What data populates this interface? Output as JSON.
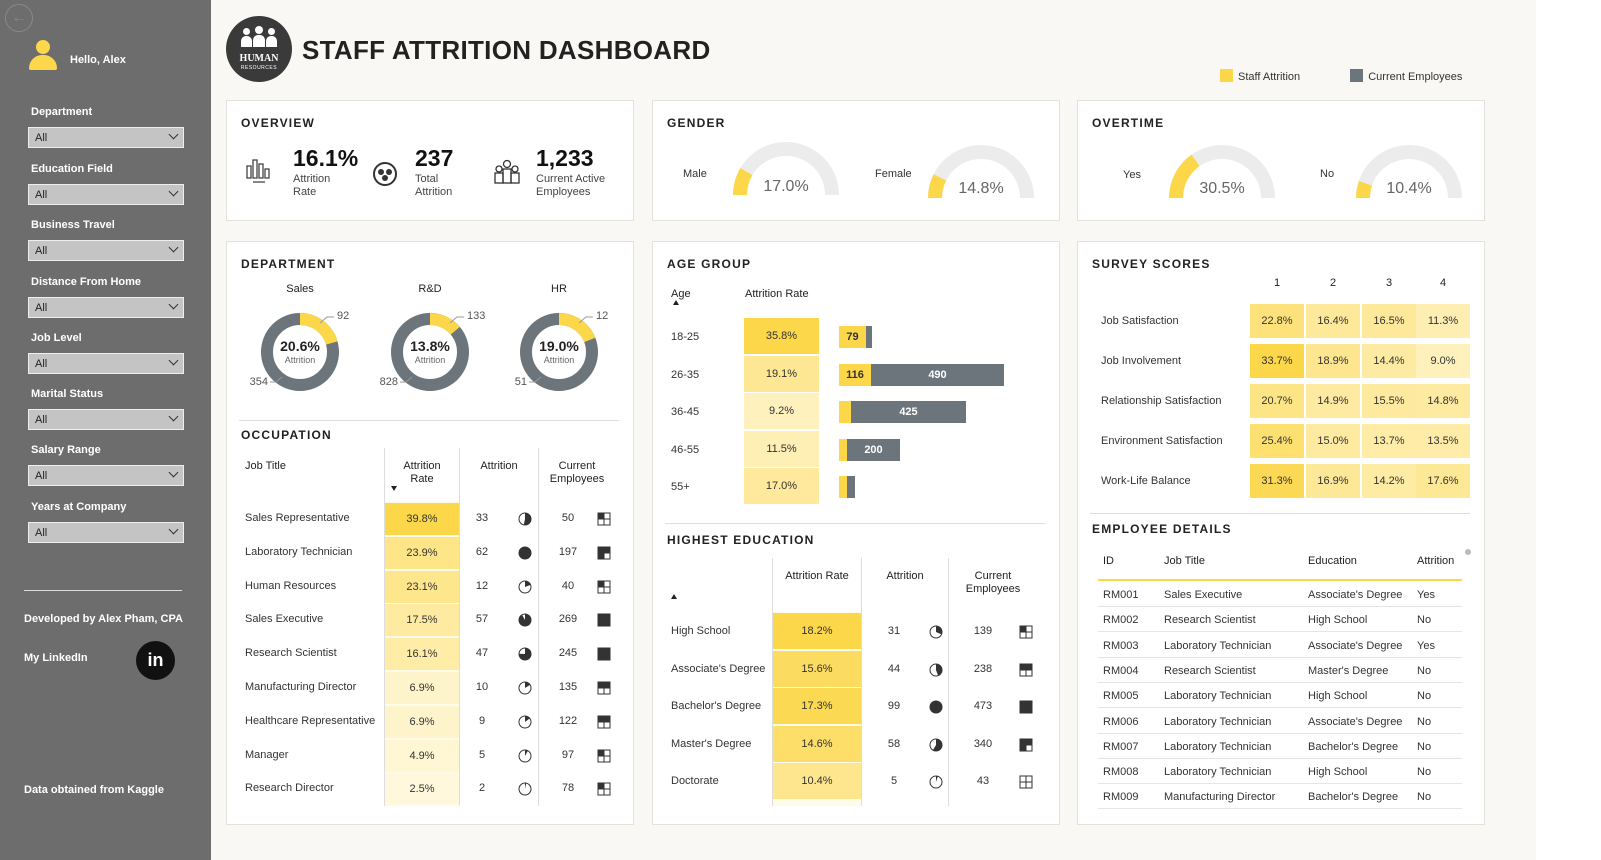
{
  "sidebar": {
    "greeting": "Hello, Alex",
    "filters": [
      {
        "label": "Department",
        "value": "All"
      },
      {
        "label": "Education Field",
        "value": "All"
      },
      {
        "label": "Business Travel",
        "value": "All"
      },
      {
        "label": "Distance From Home",
        "value": "All"
      },
      {
        "label": "Job Level",
        "value": "All"
      },
      {
        "label": "Marital Status",
        "value": "All"
      },
      {
        "label": "Salary Range",
        "value": "All"
      },
      {
        "label": "Years at Company",
        "value": "All"
      }
    ],
    "developer": "Developed by Alex Pham, CPA",
    "linkedin": "My LinkedIn",
    "linkedin_icon": "in",
    "source": "Data obtained from Kaggle"
  },
  "header": {
    "logo_text": "HUMAN",
    "logo_sub": "RESOURCES",
    "title": "STAFF ATTRITION DASHBOARD",
    "legend": [
      {
        "label": "Staff Attrition",
        "color": "#fcd74a"
      },
      {
        "label": "Current Employees",
        "color": "#6b757b"
      }
    ]
  },
  "colors": {
    "yellow": "#fcd74a",
    "gray": "#6b757b"
  },
  "overview": {
    "title": "OVERVIEW",
    "kpis": [
      {
        "value": "16.1%",
        "label1": "Attrition",
        "label2": "Rate"
      },
      {
        "value": "237",
        "label1": "Total",
        "label2": "Attrition"
      },
      {
        "value": "1,233",
        "label1": "Current Active",
        "label2": "Employees"
      }
    ]
  },
  "gender": {
    "title": "GENDER",
    "items": [
      {
        "label": "Male",
        "value": "17.0%",
        "pct": 17.0
      },
      {
        "label": "Female",
        "value": "14.8%",
        "pct": 14.8
      }
    ]
  },
  "overtime": {
    "title": "OVERTIME",
    "items": [
      {
        "label": "Yes",
        "value": "30.5%",
        "pct": 30.5
      },
      {
        "label": "No",
        "value": "10.4%",
        "pct": 10.4
      }
    ]
  },
  "department": {
    "title": "DEPARTMENT",
    "items": [
      {
        "name": "Sales",
        "rate": "20.6%",
        "sub": "Attrition",
        "attrition": 92,
        "current": 354
      },
      {
        "name": "R&D",
        "rate": "13.8%",
        "sub": "Attrition",
        "attrition": 133,
        "current": 828
      },
      {
        "name": "HR",
        "rate": "19.0%",
        "sub": "Attrition",
        "attrition": 12,
        "current": 51
      }
    ]
  },
  "occupation": {
    "title": "OCCUPATION",
    "headers": {
      "job": "Job Title",
      "rate1": "Attrition",
      "rate2": "Rate",
      "attrition": "Attrition",
      "cur1": "Current",
      "cur2": "Employees"
    },
    "rows": [
      {
        "job": "Sales Representative",
        "rate": "39.8%",
        "attr": "33",
        "cur": "50"
      },
      {
        "job": "Laboratory Technician",
        "rate": "23.9%",
        "attr": "62",
        "cur": "197"
      },
      {
        "job": "Human Resources",
        "rate": "23.1%",
        "attr": "12",
        "cur": "40"
      },
      {
        "job": "Sales Executive",
        "rate": "17.5%",
        "attr": "57",
        "cur": "269"
      },
      {
        "job": "Research Scientist",
        "rate": "16.1%",
        "attr": "47",
        "cur": "245"
      },
      {
        "job": "Manufacturing Director",
        "rate": "6.9%",
        "attr": "10",
        "cur": "135"
      },
      {
        "job": "Healthcare Representative",
        "rate": "6.9%",
        "attr": "9",
        "cur": "122"
      },
      {
        "job": "Manager",
        "rate": "4.9%",
        "attr": "5",
        "cur": "97"
      },
      {
        "job": "Research Director",
        "rate": "2.5%",
        "attr": "2",
        "cur": "78"
      }
    ]
  },
  "age": {
    "title": "AGE GROUP",
    "headers": {
      "age": "Age",
      "rate": "Attrition Rate"
    },
    "rows": [
      {
        "age": "18-25",
        "rate": "35.8%",
        "attr": "79",
        "cur": ""
      },
      {
        "age": "26-35",
        "rate": "19.1%",
        "attr": "116",
        "cur": "490"
      },
      {
        "age": "36-45",
        "rate": "9.2%",
        "attr": "",
        "cur": "425"
      },
      {
        "age": "46-55",
        "rate": "11.5%",
        "attr": "",
        "cur": "200"
      },
      {
        "age": "55+",
        "rate": "17.0%",
        "attr": "",
        "cur": ""
      }
    ]
  },
  "education": {
    "title": "HIGHEST EDUCATION",
    "headers": {
      "rate": "Attrition Rate",
      "attrition": "Attrition",
      "cur1": "Current",
      "cur2": "Employees"
    },
    "rows": [
      {
        "name": "High School",
        "rate": "18.2%",
        "attr": "31",
        "cur": "139"
      },
      {
        "name": "Associate's Degree",
        "rate": "15.6%",
        "attr": "44",
        "cur": "238"
      },
      {
        "name": "Bachelor's Degree",
        "rate": "17.3%",
        "attr": "99",
        "cur": "473"
      },
      {
        "name": "Master's Degree",
        "rate": "14.6%",
        "attr": "58",
        "cur": "340"
      },
      {
        "name": "Doctorate",
        "rate": "10.4%",
        "attr": "5",
        "cur": "43"
      }
    ]
  },
  "survey": {
    "title": "SURVEY SCORES",
    "cols": [
      "1",
      "2",
      "3",
      "4"
    ],
    "rows": [
      {
        "name": "Job Satisfaction",
        "vals": [
          "22.8%",
          "16.4%",
          "16.5%",
          "11.3%"
        ]
      },
      {
        "name": "Job Involvement",
        "vals": [
          "33.7%",
          "18.9%",
          "14.4%",
          "9.0%"
        ]
      },
      {
        "name": "Relationship Satisfaction",
        "vals": [
          "20.7%",
          "14.9%",
          "15.5%",
          "14.8%"
        ]
      },
      {
        "name": "Environment Satisfaction",
        "vals": [
          "25.4%",
          "15.0%",
          "13.7%",
          "13.5%"
        ]
      },
      {
        "name": "Work-Life Balance",
        "vals": [
          "31.3%",
          "16.9%",
          "14.2%",
          "17.6%"
        ]
      }
    ]
  },
  "employees": {
    "title": "EMPLOYEE DETAILS",
    "headers": [
      "ID",
      "Job Title",
      "Education",
      "Attrition"
    ],
    "rows": [
      [
        "RM001",
        "Sales Executive",
        "Associate's Degree",
        "Yes"
      ],
      [
        "RM002",
        "Research Scientist",
        "High School",
        "No"
      ],
      [
        "RM003",
        "Laboratory Technician",
        "Associate's Degree",
        "Yes"
      ],
      [
        "RM004",
        "Research Scientist",
        "Master's Degree",
        "No"
      ],
      [
        "RM005",
        "Laboratory Technician",
        "High School",
        "No"
      ],
      [
        "RM006",
        "Laboratory Technician",
        "Associate's Degree",
        "No"
      ],
      [
        "RM007",
        "Laboratory Technician",
        "Bachelor's Degree",
        "No"
      ],
      [
        "RM008",
        "Laboratory Technician",
        "High School",
        "No"
      ],
      [
        "RM009",
        "Manufacturing Director",
        "Bachelor's Degree",
        "No"
      ]
    ]
  }
}
